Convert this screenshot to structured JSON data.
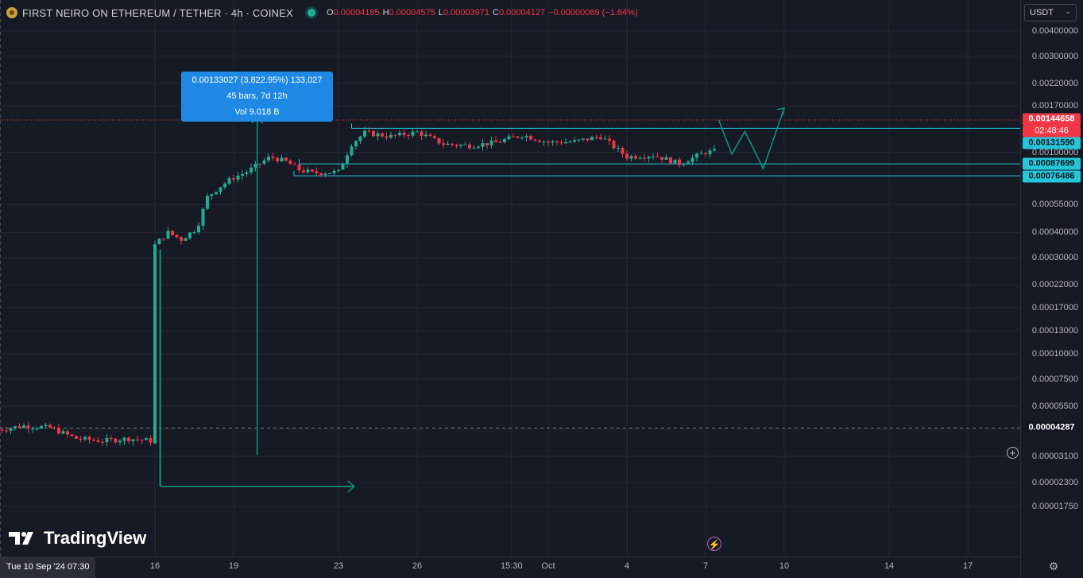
{
  "header": {
    "symbol": "FIRST NEIRO ON ETHEREUM / TETHER · 4h · COINEX",
    "o_label": "O",
    "o_value": "0.00004185",
    "h_label": "H",
    "h_value": "0.00004575",
    "l_label": "L",
    "l_value": "0.00003971",
    "c_label": "C",
    "c_value": "0.00004127",
    "change": "−0.00000069 (−1.64%)"
  },
  "currency": "USDT",
  "price_ticks": [
    "0.00400000",
    "0.00300000",
    "0.00220000",
    "0.00170000",
    "0.00100000",
    "0.00055000",
    "0.00040000",
    "0.00030000",
    "0.00022000",
    "0.00017000",
    "0.00013000",
    "0.00010000",
    "0.00007500",
    "0.00005500",
    "0.00003100",
    "0.00002300",
    "0.00001750"
  ],
  "price_labels": {
    "current": "0.00144658",
    "countdown": "02:48:46",
    "level_top": "0.00131590",
    "level_mid": "0.00087699",
    "level_low": "0.00076486",
    "crosshair": "0.00004287"
  },
  "time_ticks": [
    "16",
    "19",
    "23",
    "26",
    "15:30",
    "Oct",
    "4",
    "7",
    "10",
    "14",
    "17"
  ],
  "time_cursor": "Tue 10 Sep '24   07:30",
  "tooltip": {
    "line1": "0.00133027 (3,822.95%) 133,027",
    "line2": "45 bars, 7d 12h",
    "line3": "Vol 9.018 B"
  },
  "brand": "TradingView",
  "colors": {
    "up": "#22ab94",
    "down": "#f23645",
    "level": "#26c6da",
    "drawing": "#089981",
    "tooltip": "#1e88e5",
    "bg": "#161a25"
  },
  "chart_data": {
    "type": "candlestick",
    "title": "FIRST NEIRO ON ETHEREUM / TETHER · 4h · COINEX",
    "interval": "4h",
    "scale": "log",
    "ylim": [
      1.65e-05,
      0.0046
    ],
    "x_range": [
      "2024-09-10",
      "2024-10-19"
    ],
    "horizontal_levels": [
      0.0013159,
      0.00087699,
      0.00076486
    ],
    "current_price": 0.00144658,
    "measure": {
      "change": 0.00133027,
      "percent": 3822.95,
      "bars": 45,
      "duration": "7d 12h",
      "volume": "9.018 B"
    },
    "grid": true,
    "legend": "top-left",
    "segments": [
      {
        "period": "Sep 10 - Sep 16",
        "low": 3.15e-05,
        "high": 5.2e-05,
        "typical": 4.1e-05
      },
      {
        "period": "Sep 16 - Sep 20",
        "low": 0.00027,
        "high": 0.00106,
        "typical": 0.0006
      },
      {
        "period": "Sep 20 - Sep 23",
        "low": 0.00075,
        "high": 0.00095,
        "typical": 0.00082
      },
      {
        "period": "Sep 23 - Oct 7",
        "low": 0.00084,
        "high": 0.0014,
        "typical": 0.0011
      },
      {
        "period": "Oct 7",
        "low": 0.001,
        "high": 0.00157,
        "typical": 0.00144658
      }
    ]
  }
}
